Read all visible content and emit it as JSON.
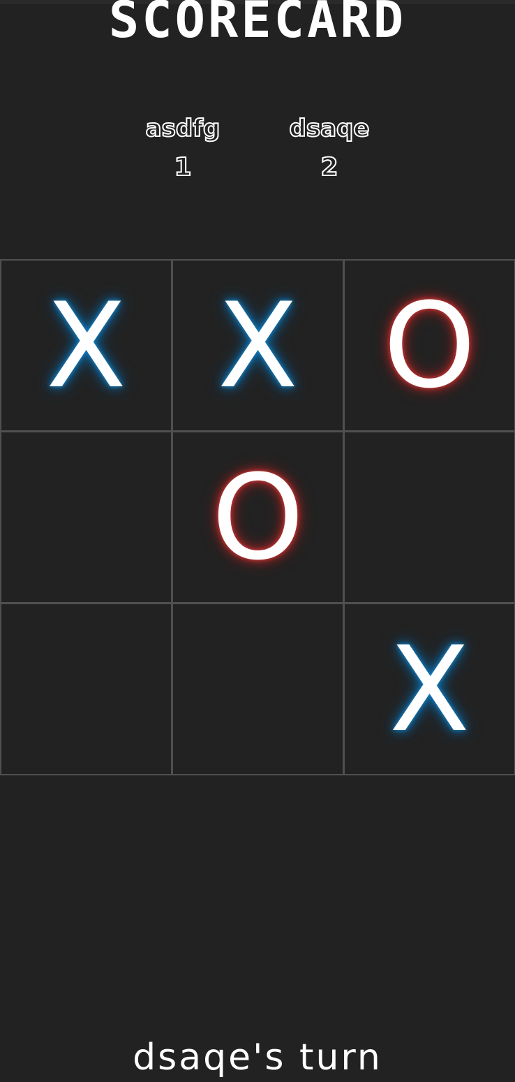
{
  "title": "SCORECARD",
  "players": [
    {
      "name": "asdfg",
      "score": "1",
      "symbol": "X"
    },
    {
      "name": "dsaqe",
      "score": "2",
      "symbol": "O"
    }
  ],
  "board": {
    "cells": [
      "X",
      "X",
      "O",
      "",
      "O",
      "",
      "",
      "",
      "X"
    ]
  },
  "status": {
    "turn_text": "dsaqe's turn"
  },
  "colors": {
    "background": "#222222",
    "grid_line": "#505050",
    "x_glow": "#0b6fb0",
    "o_glow": "#b52a2a",
    "text": "#ffffff"
  }
}
